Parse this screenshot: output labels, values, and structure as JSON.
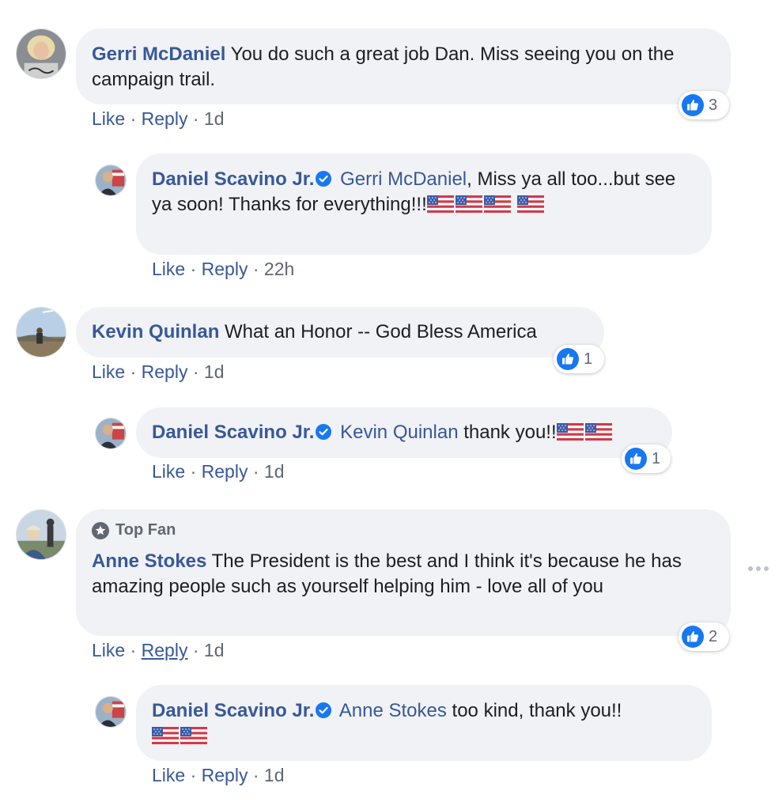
{
  "actions": {
    "like": "Like",
    "reply": "Reply",
    "sep": "·"
  },
  "colors": {
    "author": "#385898",
    "bubble": "#f0f2f5",
    "like_blue": "#1877f2"
  },
  "comments": [
    {
      "author": "Gerri McDaniel",
      "text": "You do such a great job Dan. Miss seeing you on the campaign trail.",
      "time": "1d",
      "reactions": "3",
      "reply": {
        "author": "Daniel Scavino Jr.",
        "mention": "Gerri McDaniel",
        "text": ", Miss ya all too...but see ya soon! Thanks for everything!!!",
        "time": "22h"
      }
    },
    {
      "author": "Kevin Quinlan",
      "text": "What an Honor -- God Bless America",
      "time": "1d",
      "reactions": "1",
      "reply": {
        "author": "Daniel Scavino Jr.",
        "mention": "Kevin Quinlan",
        "text": " thank you!!",
        "time": "1d",
        "reactions": "1"
      }
    },
    {
      "badge": "Top Fan",
      "author": "Anne Stokes",
      "text": "The President is the best and I think it's because he has amazing people such as yourself helping him - love all of you",
      "time": "1d",
      "reactions": "2",
      "reply": {
        "author": "Daniel Scavino Jr.",
        "mention": "Anne Stokes",
        "text": " too kind, thank you!!",
        "time": "1d"
      }
    }
  ],
  "icons": {
    "verified": "verified-badge-icon",
    "like": "thumbs-up-icon",
    "flag": "us-flag-icon",
    "top_fan": "star-badge-icon",
    "more": "more-options-icon"
  }
}
